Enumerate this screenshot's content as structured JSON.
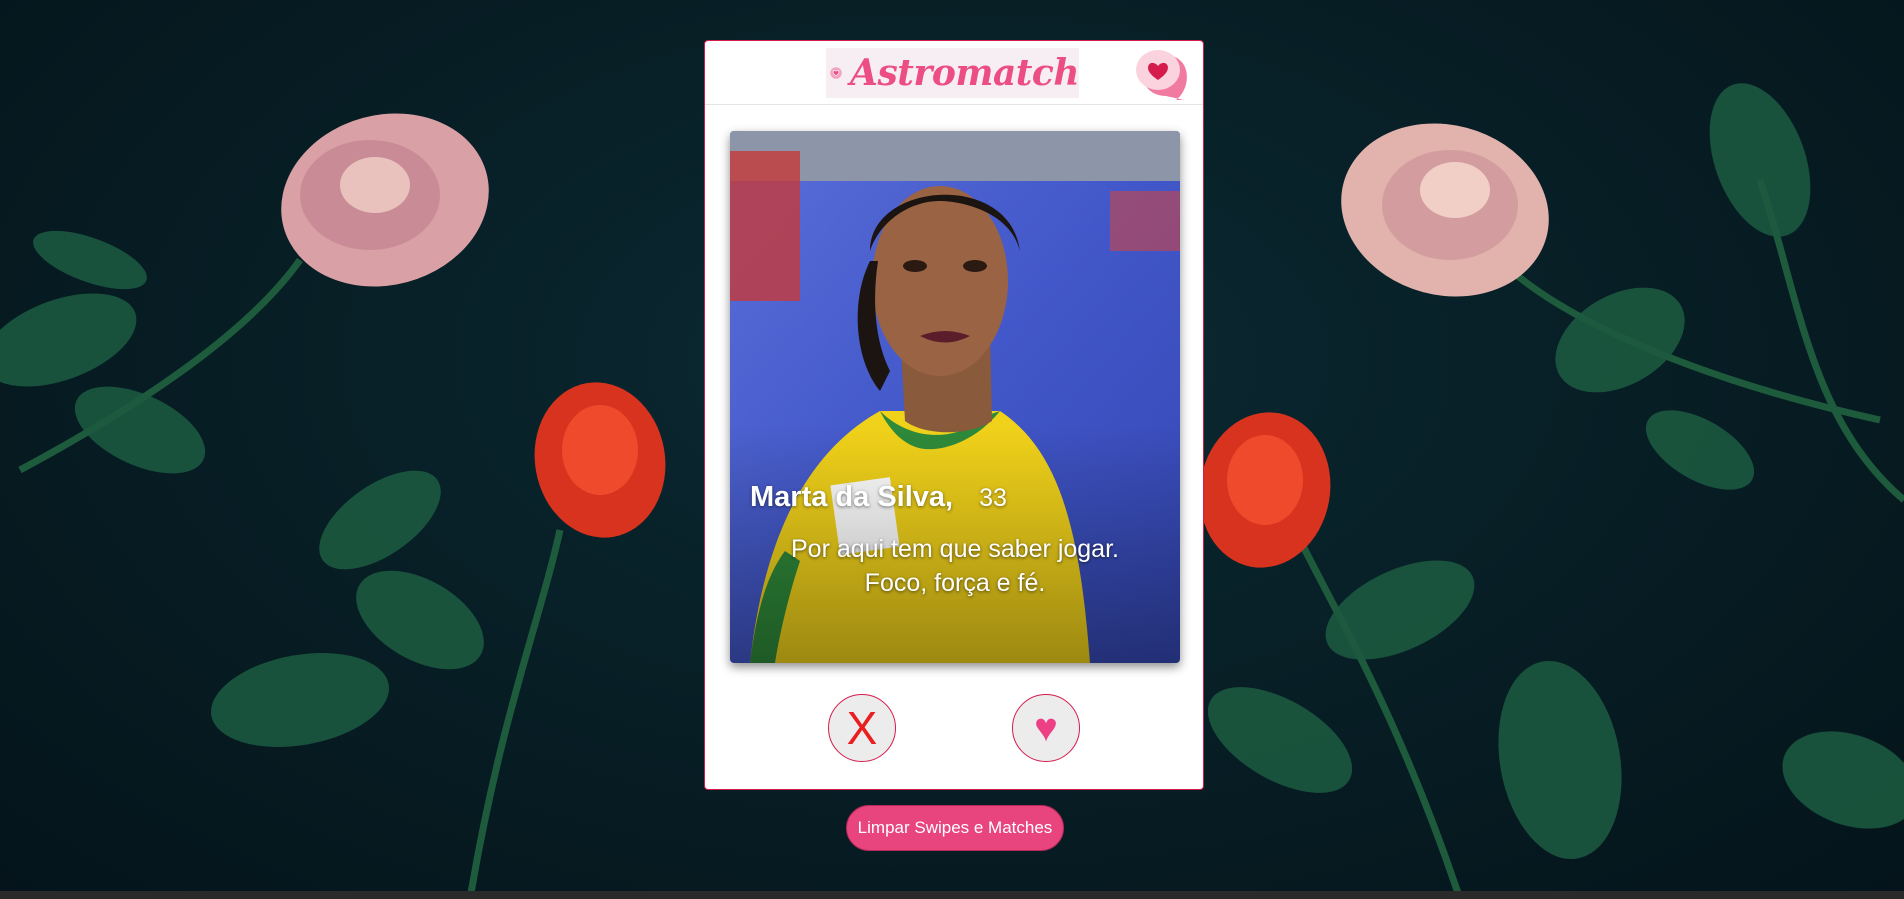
{
  "header": {
    "app_name": "Astromatch",
    "logo_icon": "heart-icon",
    "matches_icon": "chat-heart-icon"
  },
  "profile": {
    "name": "Marta da Silva,",
    "age": "33",
    "bio": "Por aqui tem que saber jogar. Foco, força e fé.",
    "photo_alt": "profile photo"
  },
  "actions": {
    "reject_label": "X",
    "like_label": "♥"
  },
  "footer": {
    "clear_label": "Limpar Swipes e Matches"
  },
  "colors": {
    "accent": "#ec4d83",
    "border": "#d41b4b",
    "reject": "#ea1e1e",
    "like": "#ec3f86",
    "clear_button": "#e8447e"
  }
}
